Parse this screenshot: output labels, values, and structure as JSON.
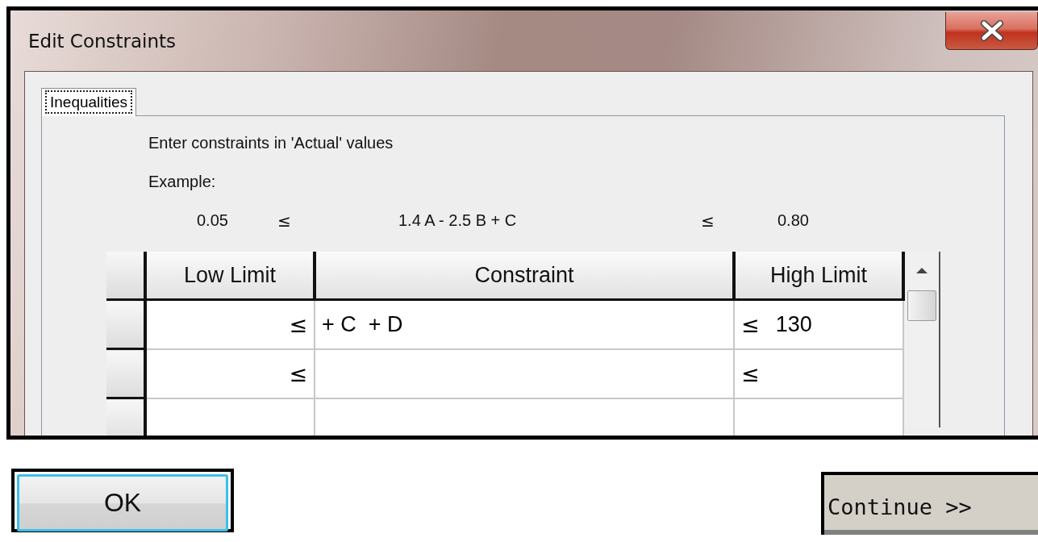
{
  "window": {
    "title": "Edit Constraints"
  },
  "tabs": [
    {
      "label": "Inequalities",
      "selected": true
    }
  ],
  "instructions": "Enter constraints in 'Actual' values",
  "example": {
    "label": "Example:",
    "low_limit": "0.05",
    "low_op": "≤",
    "constraint": "1.4 A - 2.5 B + C",
    "high_op": "≤",
    "high_limit": "0.80"
  },
  "table": {
    "columns": [
      "Low Limit",
      "Constraint",
      "High Limit"
    ],
    "rows": [
      {
        "low_op": "≤",
        "constraint": "+ C  + D",
        "high_op": "≤",
        "high_limit": "130"
      },
      {
        "low_op": "≤",
        "high_op": "≤"
      },
      {}
    ]
  },
  "buttons": [
    {
      "label": "OK",
      "kind": "default"
    },
    {
      "label": "Continue >>",
      "kind": "plain"
    }
  ]
}
